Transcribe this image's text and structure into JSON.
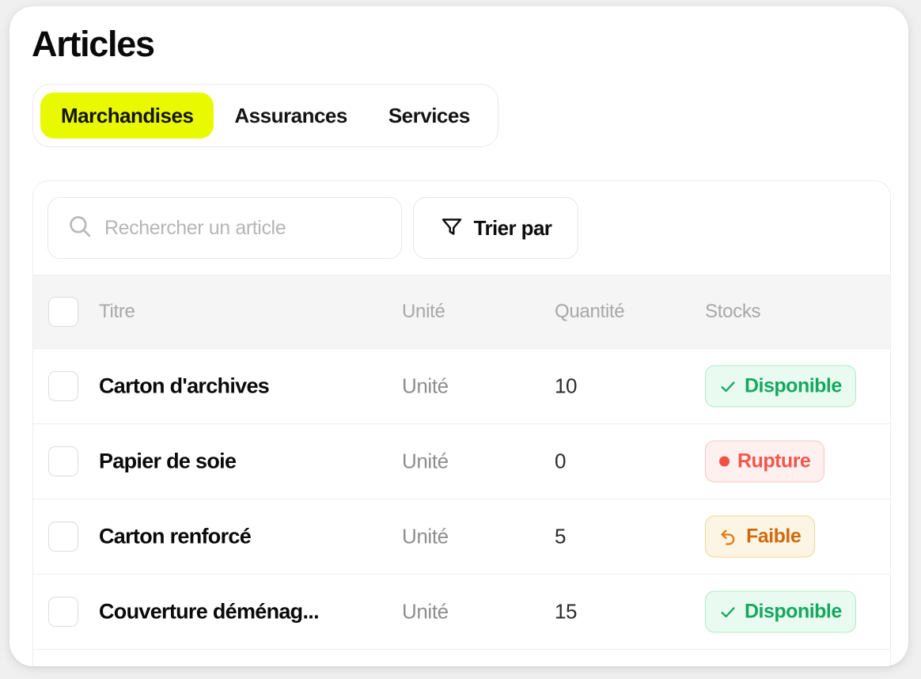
{
  "page": {
    "title": "Articles"
  },
  "tabs": [
    {
      "label": "Marchandises",
      "active": true
    },
    {
      "label": "Assurances",
      "active": false
    },
    {
      "label": "Services",
      "active": false
    }
  ],
  "toolbar": {
    "search": {
      "value": "",
      "placeholder": "Rechercher un article",
      "icon": "search-icon"
    },
    "sort": {
      "label": "Trier par",
      "icon": "filter-funnel-icon"
    }
  },
  "table": {
    "select_all_checked": false,
    "columns": [
      "Titre",
      "Unité",
      "Quantité",
      "Stocks"
    ],
    "rows": [
      {
        "checked": false,
        "title": "Carton d'archives",
        "unit": "Unité",
        "quantity": "10",
        "status": {
          "label": "Disponible",
          "kind": "ok",
          "icon": "check-icon"
        }
      },
      {
        "checked": false,
        "title": "Papier de soie",
        "unit": "Unité",
        "quantity": "0",
        "status": {
          "label": "Rupture",
          "kind": "out",
          "icon": "dot-icon"
        }
      },
      {
        "checked": false,
        "title": "Carton renforcé",
        "unit": "Unité",
        "quantity": "5",
        "status": {
          "label": "Faible",
          "kind": "low",
          "icon": "undo-arrow-icon"
        }
      },
      {
        "checked": false,
        "title": "Couverture déménag...",
        "unit": "Unité",
        "quantity": "15",
        "status": {
          "label": "Disponible",
          "kind": "ok",
          "icon": "check-icon"
        }
      }
    ]
  },
  "colors": {
    "accent_tab": "#e9f900",
    "status_available": "#16a860",
    "status_out": "#f2574c",
    "status_low": "#cf6a10",
    "header_bg": "#f5f5f5",
    "surface": "#ffffff"
  }
}
